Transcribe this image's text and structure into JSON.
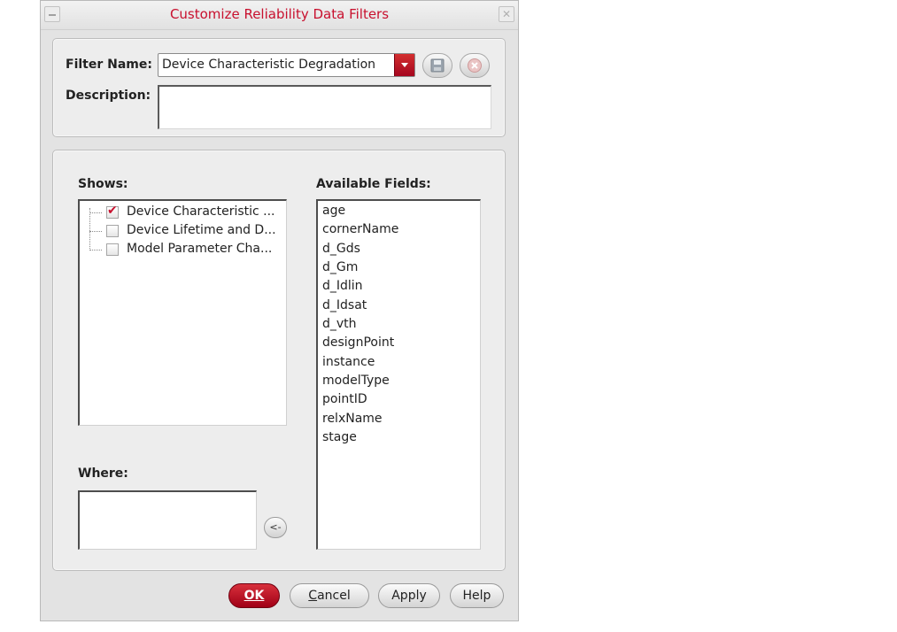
{
  "window": {
    "title": "Customize Reliability Data Filters"
  },
  "filter": {
    "name_label": "Filter Name:",
    "name_value": "Device Characteristic Degradation",
    "description_label": "Description:",
    "description_value": ""
  },
  "shows": {
    "label": "Shows:",
    "items": [
      {
        "label": "Device Characteristic ...",
        "checked": true
      },
      {
        "label": "Device Lifetime and D...",
        "checked": false
      },
      {
        "label": "Model Parameter Cha...",
        "checked": false
      }
    ]
  },
  "available_fields": {
    "label": "Available Fields:",
    "items": [
      "age",
      "cornerName",
      "d_Gds",
      "d_Gm",
      "d_Idlin",
      "d_Idsat",
      "d_vth",
      "designPoint",
      "instance",
      "modelType",
      "pointID",
      "relxName",
      "stage"
    ]
  },
  "where": {
    "label": "Where:",
    "value": "",
    "move_button_label": "<-"
  },
  "buttons": {
    "ok": "OK",
    "cancel_rest": "ancel",
    "cancel_mnemonic": "C",
    "apply": "Apply",
    "help": "Help"
  },
  "colors": {
    "accent": "#c8102e",
    "dialog_bg": "#e3e3e3"
  }
}
